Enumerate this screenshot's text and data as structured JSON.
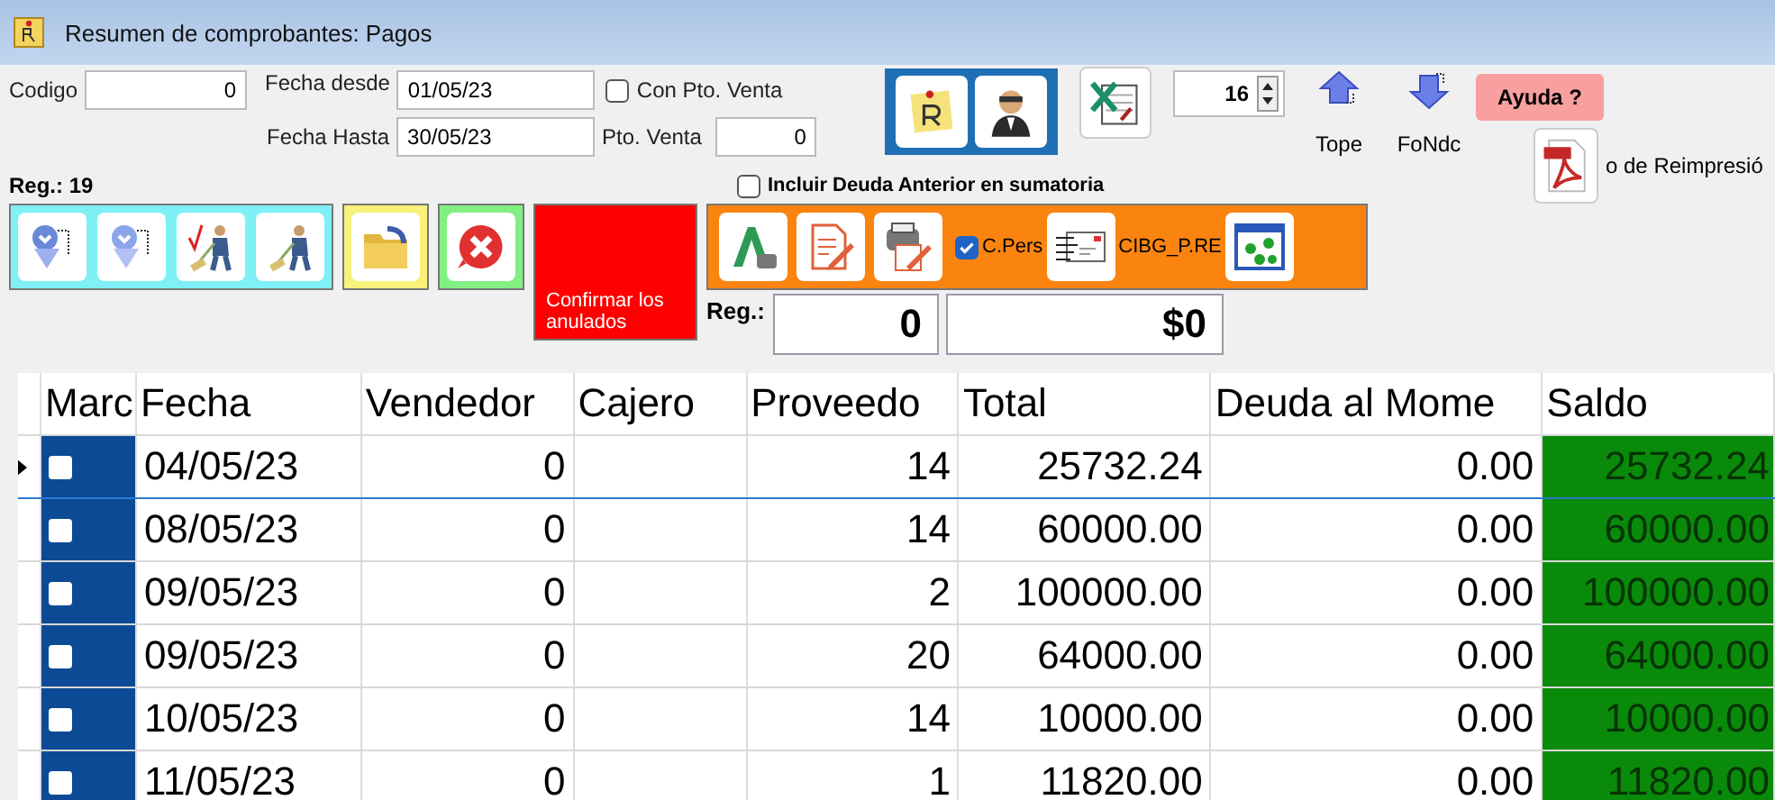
{
  "window": {
    "title": "Resumen de comprobantes: Pagos"
  },
  "filters": {
    "codigo_label": "Codigo",
    "codigo": "0",
    "fecha_desde_label": "Fecha desde",
    "fecha_desde": "01/05/23",
    "fecha_hasta_label": "Fecha Hasta",
    "fecha_hasta": "30/05/23",
    "con_pto_venta": {
      "label": "Con Pto. Venta",
      "checked": false
    },
    "pto_venta_label": "Pto. Venta",
    "pto_venta": "0"
  },
  "spinner_value": "16",
  "tope_label": "Tope",
  "fondo_label": "FoNdc",
  "help_button": "Ayuda ?",
  "reprint_label": "o de Reimpresió",
  "reg_count": "Reg.: 19",
  "incluir_deuda": {
    "label": "Incluir Deuda Anterior en sumatoria",
    "checked": false
  },
  "confirm_button": "Confirmar los anulados",
  "c_pers": {
    "label": "C.Pers",
    "checked": true
  },
  "cibg_label": "CIBG_P.RE",
  "totals": {
    "label": "Reg.:",
    "count": "0",
    "amount": "$0"
  },
  "table": {
    "columns": [
      "Marc",
      "Fecha",
      "Vendedor",
      "Cajero",
      "Proveedo",
      "Total",
      "Deuda al Mome",
      "Saldo"
    ],
    "rows": [
      {
        "current": true,
        "marked": false,
        "cells": [
          "",
          "04/05/23",
          "0",
          "",
          "14",
          "25732.24",
          "0.00",
          "25732.24"
        ]
      },
      {
        "current": false,
        "marked": false,
        "cells": [
          "",
          "08/05/23",
          "0",
          "",
          "14",
          "60000.00",
          "0.00",
          "60000.00"
        ]
      },
      {
        "current": false,
        "marked": false,
        "cells": [
          "",
          "09/05/23",
          "0",
          "",
          "2",
          "100000.00",
          "0.00",
          "100000.00"
        ]
      },
      {
        "current": false,
        "marked": false,
        "cells": [
          "",
          "09/05/23",
          "0",
          "",
          "20",
          "64000.00",
          "0.00",
          "64000.00"
        ]
      },
      {
        "current": false,
        "marked": false,
        "cells": [
          "",
          "10/05/23",
          "0",
          "",
          "14",
          "10000.00",
          "0.00",
          "10000.00"
        ]
      },
      {
        "current": false,
        "marked": false,
        "cells": [
          "",
          "11/05/23",
          "0",
          "",
          "1",
          "11820.00",
          "0.00",
          "11820.00"
        ]
      }
    ]
  }
}
